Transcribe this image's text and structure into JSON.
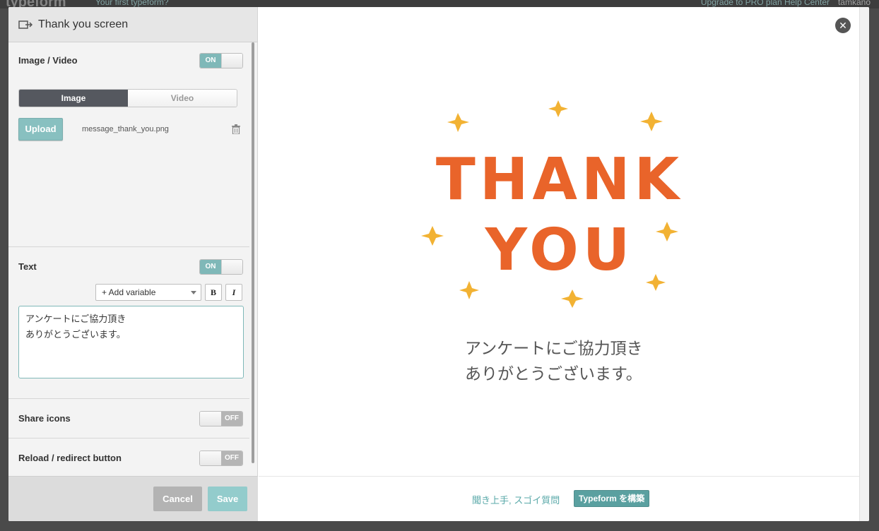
{
  "background": {
    "logo": "typeform",
    "form_name": "Your first typeform?",
    "links": "Upgrade to PRO plan   Help Center",
    "user": "tamkano"
  },
  "panel": {
    "title": "Thank you screen",
    "image_video": {
      "label": "Image / Video",
      "toggle": "ON",
      "tabs": [
        "Image",
        "Video"
      ],
      "active_tab": "Image",
      "upload_label": "Upload",
      "filename": "message_thank_you.png"
    },
    "text": {
      "label": "Text",
      "toggle": "ON",
      "add_variable": "+ Add variable",
      "bold": "B",
      "italic": "I",
      "content": "アンケートにご協力頂き\nありがとうございます。"
    },
    "share_icons": {
      "label": "Share icons",
      "toggle": "OFF"
    },
    "reload": {
      "label": "Reload / redirect button",
      "toggle": "OFF"
    },
    "cancel": "Cancel",
    "save": "Save"
  },
  "preview": {
    "close": "✕",
    "art_line1": "THANK",
    "art_line2": "YOU",
    "message": "アンケートにご協力頂き\nありがとうございます。",
    "tagline": "聞き上手, スゴイ質問",
    "build_button": "Typeform を構築"
  },
  "colors": {
    "accent": "#7fb8b8",
    "art_orange": "#e9642a",
    "star_yellow": "#f2b233",
    "dark_tab": "#55585f"
  }
}
